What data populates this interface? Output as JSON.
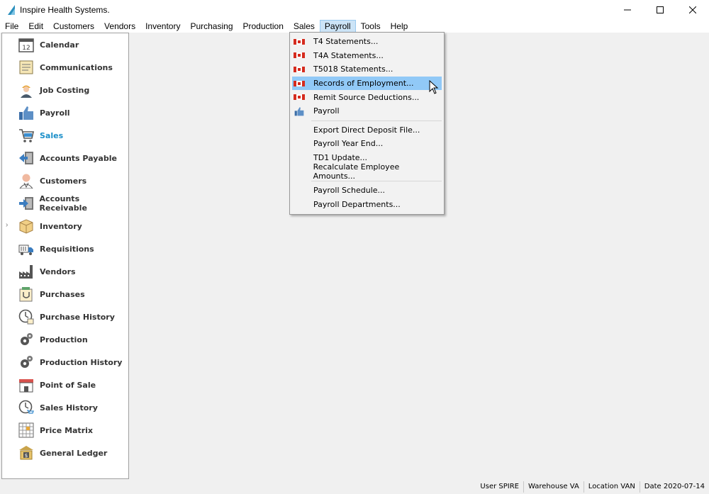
{
  "window": {
    "title": "Inspire Health Systems."
  },
  "menubar": {
    "items": [
      "File",
      "Edit",
      "Customers",
      "Vendors",
      "Inventory",
      "Purchasing",
      "Production",
      "Sales",
      "Payroll",
      "Tools",
      "Help"
    ],
    "active": "Payroll"
  },
  "sidebar": {
    "items": [
      {
        "label": "Calendar",
        "icon": "calendar-icon"
      },
      {
        "label": "Communications",
        "icon": "notepad-icon"
      },
      {
        "label": "Job Costing",
        "icon": "worker-icon"
      },
      {
        "label": "Payroll",
        "icon": "thumbs-up-icon"
      },
      {
        "label": "Sales",
        "icon": "shopping-cart-icon",
        "selected": true
      },
      {
        "label": "Accounts Payable",
        "icon": "payable-icon"
      },
      {
        "label": "Customers",
        "icon": "person-icon"
      },
      {
        "label": "Accounts Receivable",
        "icon": "receivable-icon"
      },
      {
        "label": "Inventory",
        "icon": "box-icon",
        "expandable": true
      },
      {
        "label": "Requisitions",
        "icon": "truck-icon"
      },
      {
        "label": "Vendors",
        "icon": "factory-icon"
      },
      {
        "label": "Purchases",
        "icon": "purchase-icon"
      },
      {
        "label": "Purchase History",
        "icon": "clock-icon"
      },
      {
        "label": "Production",
        "icon": "gears-icon"
      },
      {
        "label": "Production History",
        "icon": "gears-icon"
      },
      {
        "label": "Point of Sale",
        "icon": "store-icon"
      },
      {
        "label": "Sales History",
        "icon": "clock-icon"
      },
      {
        "label": "Price Matrix",
        "icon": "grid-icon"
      },
      {
        "label": "General Ledger",
        "icon": "ledger-icon"
      }
    ]
  },
  "payroll_menu": {
    "groups": [
      [
        {
          "label": "T4 Statements...",
          "icon": "canada-flag-icon"
        },
        {
          "label": "T4A Statements...",
          "icon": "canada-flag-icon"
        },
        {
          "label": "T5018 Statements...",
          "icon": "canada-flag-icon"
        },
        {
          "label": "Records of Employment...",
          "icon": "canada-flag-icon",
          "hover": true
        },
        {
          "label": "Remit Source Deductions...",
          "icon": "canada-flag-icon"
        },
        {
          "label": "Payroll",
          "icon": "thumbs-up-icon"
        }
      ],
      [
        {
          "label": "Export Direct Deposit File..."
        },
        {
          "label": "Payroll Year End..."
        },
        {
          "label": "TD1 Update..."
        },
        {
          "label": "Recalculate Employee Amounts..."
        }
      ],
      [
        {
          "label": "Payroll Schedule..."
        },
        {
          "label": "Payroll Departments..."
        }
      ]
    ]
  },
  "statusbar": {
    "user": "User  SPIRE",
    "warehouse": "Warehouse  VA",
    "location": "Location  VAN",
    "date": "Date  2020-07-14"
  },
  "colors": {
    "selected_text": "#1b8fc9",
    "menu_hover": "#91c9f7",
    "flag_red": "#d52b1e"
  }
}
